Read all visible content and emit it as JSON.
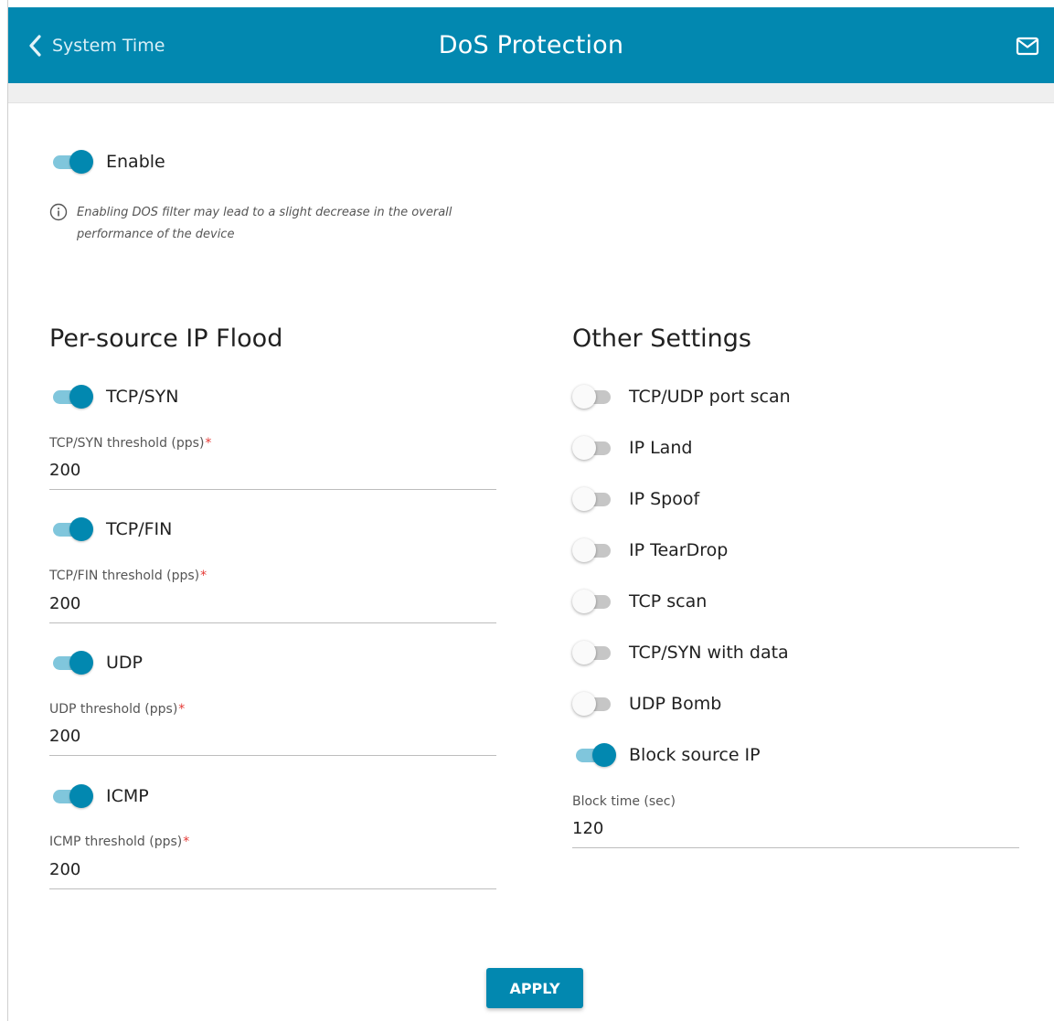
{
  "header": {
    "back_label": "System Time",
    "title": "DoS Protection",
    "back_icon": "chevron-left-icon",
    "mail_icon": "mail-icon",
    "color": "#0288b0"
  },
  "enable": {
    "label": "Enable",
    "checked": true,
    "info_text": "Enabling DOS filter may lead to a slight decrease in the overall performance of the device"
  },
  "flood": {
    "title": "Per-source IP Flood",
    "items": [
      {
        "label": "TCP/SYN",
        "checked": true,
        "threshold_label": "TCP/SYN threshold (pps)",
        "required": "*",
        "value": "200"
      },
      {
        "label": "TCP/FIN",
        "checked": true,
        "threshold_label": "TCP/FIN threshold (pps)",
        "required": "*",
        "value": "200"
      },
      {
        "label": "UDP",
        "checked": true,
        "threshold_label": "UDP threshold (pps)",
        "required": "*",
        "value": "200"
      },
      {
        "label": "ICMP",
        "checked": true,
        "threshold_label": "ICMP threshold (pps)",
        "required": "*",
        "value": "200"
      }
    ]
  },
  "other": {
    "title": "Other Settings",
    "items": [
      {
        "label": "TCP/UDP port scan",
        "checked": false
      },
      {
        "label": "IP Land",
        "checked": false
      },
      {
        "label": "IP Spoof",
        "checked": false
      },
      {
        "label": "IP TearDrop",
        "checked": false
      },
      {
        "label": "TCP scan",
        "checked": false
      },
      {
        "label": "TCP/SYN with data",
        "checked": false
      },
      {
        "label": "UDP Bomb",
        "checked": false
      },
      {
        "label": "Block source IP",
        "checked": true
      }
    ],
    "block_time_label": "Block time (sec)",
    "block_time_value": "120"
  },
  "apply_label": "APPLY"
}
